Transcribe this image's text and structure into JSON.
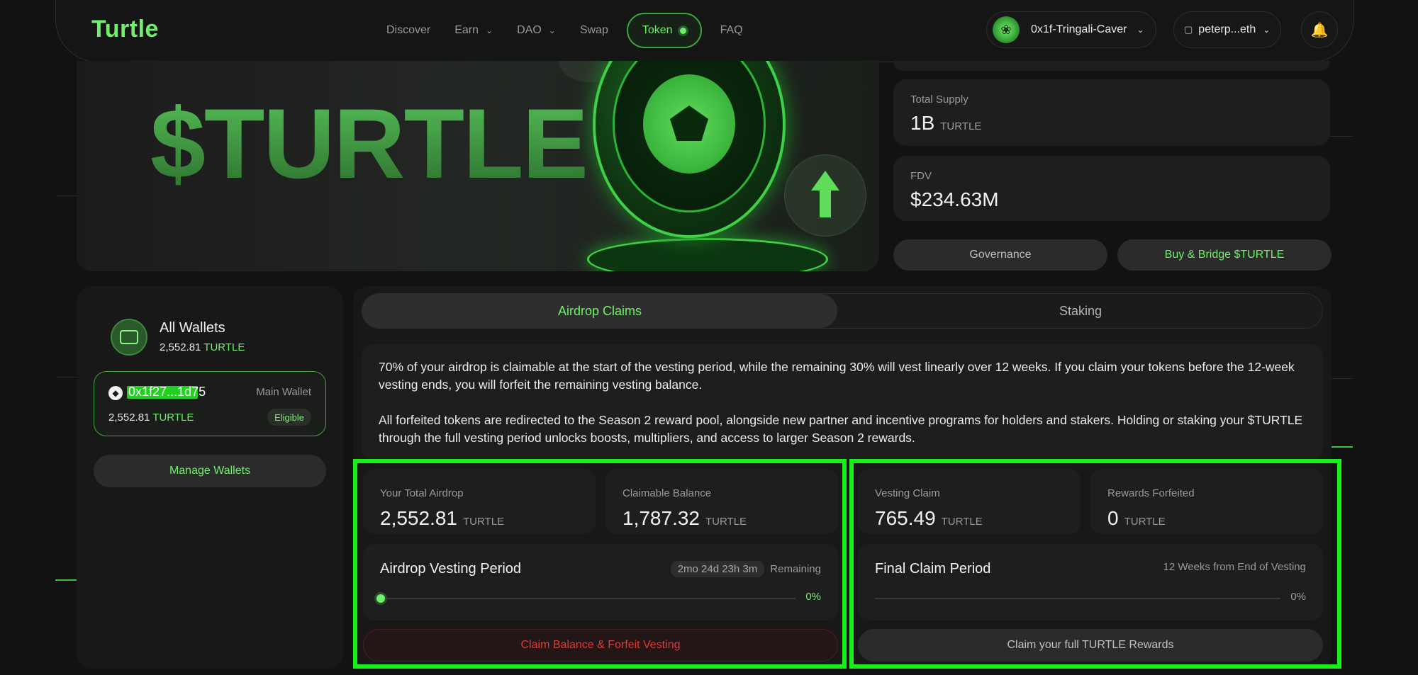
{
  "nav": {
    "logo": "Turtle",
    "links": [
      {
        "label": "Discover"
      },
      {
        "label": "Earn"
      },
      {
        "label": "DAO"
      },
      {
        "label": "Swap"
      },
      {
        "label": "Token"
      },
      {
        "label": "FAQ"
      }
    ],
    "account_name": "0x1f-Tringali-Caver",
    "ens_name": "peterp...eth"
  },
  "hero": {
    "title": "$TURTLE"
  },
  "stats": {
    "total_supply_label": "Total Supply",
    "total_supply_value": "1B",
    "total_supply_unit": "TURTLE",
    "fdv_label": "FDV",
    "fdv_value": "$234.63M",
    "governance_label": "Governance",
    "buy_bridge_label": "Buy & Bridge $TURTLE"
  },
  "wallets": {
    "title": "All Wallets",
    "total_amount": "2,552.81",
    "unit": "TURTLE",
    "items": [
      {
        "address": "0x1f27...1d75",
        "tag": "Main Wallet",
        "amount": "2,552.81",
        "unit": "TURTLE",
        "status": "Eligible"
      }
    ],
    "manage_label": "Manage Wallets"
  },
  "tabs": {
    "airdrop": "Airdrop Claims",
    "staking": "Staking"
  },
  "info": {
    "p1": "70% of your airdrop is claimable at the start of the vesting period, while the remaining 30% will vest linearly over 12 weeks. If you claim your tokens before the 12-week vesting ends, you will forfeit the remaining vesting balance.",
    "p2": "All forfeited tokens are redirected to the Season 2 reward pool, alongside new partner and incentive programs for holders and stakers. Holding or staking your $TURTLE through the full vesting period unlocks boosts, multipliers, and access to larger Season 2 rewards."
  },
  "cards": {
    "total_airdrop_label": "Your Total Airdrop",
    "total_airdrop_value": "2,552.81",
    "claimable_label": "Claimable Balance",
    "claimable_value": "1,787.32",
    "vesting_claim_label": "Vesting Claim",
    "vesting_claim_value": "765.49",
    "forfeited_label": "Rewards Forfeited",
    "forfeited_value": "0",
    "unit": "TURTLE"
  },
  "vesting": {
    "title": "Airdrop Vesting Period",
    "countdown": "2mo 24d 23h 3m",
    "remaining": "Remaining",
    "progress": "0%",
    "progress_value": 0
  },
  "final_claim": {
    "title": "Final Claim Period",
    "subtitle": "12 Weeks from End of Vesting",
    "progress": "0%",
    "progress_value": 0
  },
  "actions": {
    "claim_forfeit": "Claim Balance & Forfeit Vesting",
    "claim_full": "Claim your full TURTLE Rewards"
  },
  "colors": {
    "accent": "#6ff06a",
    "danger": "#e03a3a",
    "highlight": "#19f019",
    "background": "#121212"
  }
}
